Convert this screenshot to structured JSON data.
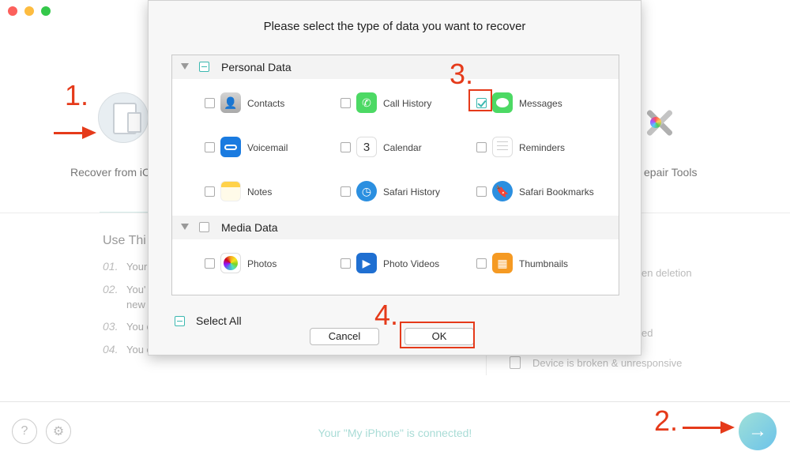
{
  "window": {
    "traffic_colors": [
      "#fc605c",
      "#fdbc40",
      "#34c84a"
    ]
  },
  "background": {
    "recover_from_label": "Recover from iC",
    "repair_tools_label": "epair Tools",
    "use_title": "Use Thi",
    "steps": [
      {
        "num": "01.",
        "text": "Your"
      },
      {
        "num": "02.",
        "text": "You'"
      },
      {
        "num": "",
        "text": "new"
      },
      {
        "num": "03.",
        "text": "You c"
      },
      {
        "num": "04.",
        "text": "You c"
      }
    ],
    "right_items": [
      "en deletion",
      "ed",
      "Device is broken & unresponsive"
    ],
    "status": "Your \"My iPhone\" is connected!"
  },
  "dialog": {
    "title": "Please select the type of data you want to recover",
    "sections": [
      {
        "label": "Personal Data",
        "items": [
          {
            "label": "Contacts",
            "icon": "contacts-icon",
            "checked": false
          },
          {
            "label": "Call History",
            "icon": "phone-icon",
            "checked": false
          },
          {
            "label": "Messages",
            "icon": "messages-icon",
            "checked": true
          },
          {
            "label": "Voicemail",
            "icon": "voicemail-icon",
            "checked": false
          },
          {
            "label": "Calendar",
            "icon": "calendar-icon",
            "checked": false,
            "day": "3"
          },
          {
            "label": "Reminders",
            "icon": "reminders-icon",
            "checked": false
          },
          {
            "label": "Notes",
            "icon": "notes-icon",
            "checked": false
          },
          {
            "label": "Safari History",
            "icon": "safari-icon",
            "checked": false
          },
          {
            "label": "Safari Bookmarks",
            "icon": "safari-bookmarks-icon",
            "checked": false
          }
        ]
      },
      {
        "label": "Media Data",
        "items": [
          {
            "label": "Photos",
            "icon": "photos-icon",
            "checked": false
          },
          {
            "label": "Photo Videos",
            "icon": "photo-videos-icon",
            "checked": false
          },
          {
            "label": "Thumbnails",
            "icon": "thumbnails-icon",
            "checked": false
          }
        ]
      }
    ],
    "select_all": "Select All",
    "cancel": "Cancel",
    "ok": "OK"
  },
  "annotations": [
    "1.",
    "2.",
    "3.",
    "4."
  ],
  "colors": {
    "accent": "#3cb8b0",
    "annotation": "#e53a1a",
    "status": "#a9dcd6"
  }
}
